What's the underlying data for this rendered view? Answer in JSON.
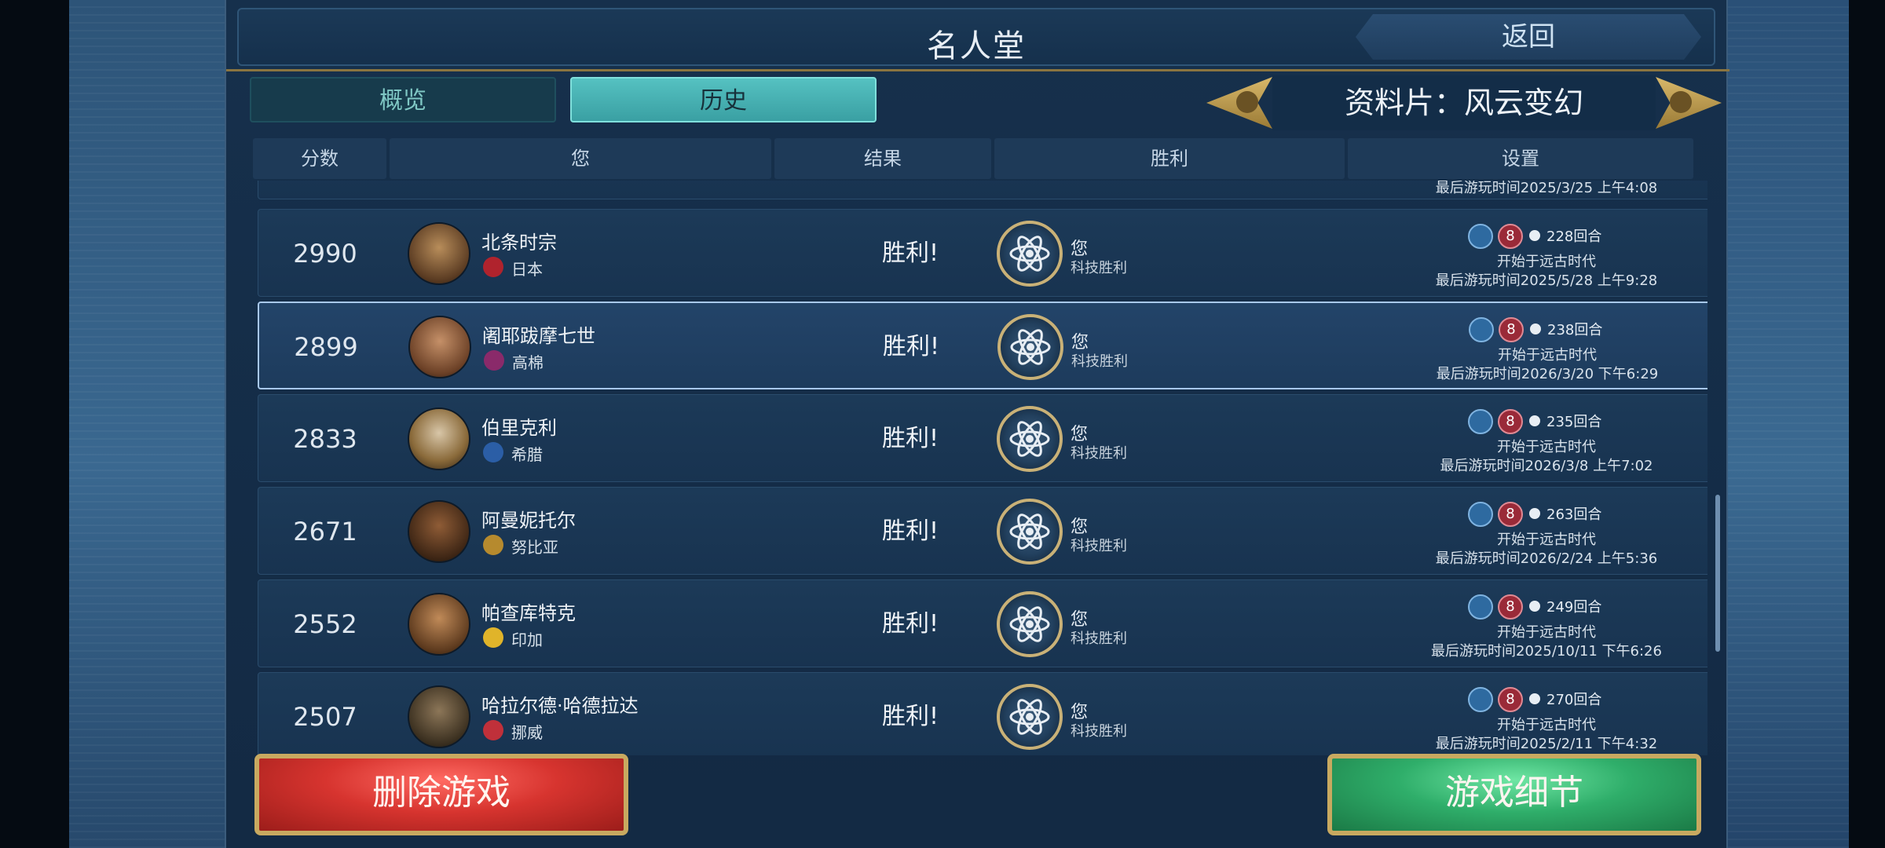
{
  "header": {
    "title": "名人堂",
    "back_label": "返回"
  },
  "tabs": [
    {
      "label": "概览",
      "active": false
    },
    {
      "label": "历史",
      "active": true
    }
  ],
  "expansion": {
    "label": "资料片：风云变幻"
  },
  "table": {
    "columns": [
      "分数",
      "您",
      "结果",
      "胜利",
      "设置"
    ],
    "partial_row_text": "最后游玩时间2025/3/25 上午4:08",
    "rows": [
      {
        "score": "2990",
        "leader": "北条时宗",
        "civ": "日本",
        "result": "胜利!",
        "victory_player": "您",
        "victory_type": "科技胜利",
        "turns": "228回合",
        "start": "开始于远古时代",
        "last_played": "最后游玩时间2025/5/28 上午9:28",
        "selected": false
      },
      {
        "score": "2899",
        "leader": "阇耶跋摩七世",
        "civ": "高棉",
        "result": "胜利!",
        "victory_player": "您",
        "victory_type": "科技胜利",
        "turns": "238回合",
        "start": "开始于远古时代",
        "last_played": "最后游玩时间2026/3/20 下午6:29",
        "selected": true
      },
      {
        "score": "2833",
        "leader": "伯里克利",
        "civ": "希腊",
        "result": "胜利!",
        "victory_player": "您",
        "victory_type": "科技胜利",
        "turns": "235回合",
        "start": "开始于远古时代",
        "last_played": "最后游玩时间2026/3/8 上午7:02",
        "selected": false
      },
      {
        "score": "2671",
        "leader": "阿曼妮托尔",
        "civ": "努比亚",
        "result": "胜利!",
        "victory_player": "您",
        "victory_type": "科技胜利",
        "turns": "263回合",
        "start": "开始于远古时代",
        "last_played": "最后游玩时间2026/2/24 上午5:36",
        "selected": false
      },
      {
        "score": "2552",
        "leader": "帕查库特克",
        "civ": "印加",
        "result": "胜利!",
        "victory_player": "您",
        "victory_type": "科技胜利",
        "turns": "249回合",
        "start": "开始于远古时代",
        "last_played": "最后游玩时间2025/10/11 下午6:26",
        "selected": false
      },
      {
        "score": "2507",
        "leader": "哈拉尔德·哈德拉达",
        "civ": "挪威",
        "result": "胜利!",
        "victory_player": "您",
        "victory_type": "科技胜利",
        "turns": "270回合",
        "start": "开始于远古时代",
        "last_played": "最后游玩时间2025/2/11 下午4:32",
        "selected": false
      }
    ]
  },
  "difficulty_badge": "8",
  "buttons": {
    "delete": "删除游戏",
    "details": "游戏细节"
  },
  "colors": {
    "gold": "#c8a960",
    "teal_tab": "#3aa0a3",
    "delete_red": "#d7342f",
    "details_green": "#2fae6a"
  }
}
